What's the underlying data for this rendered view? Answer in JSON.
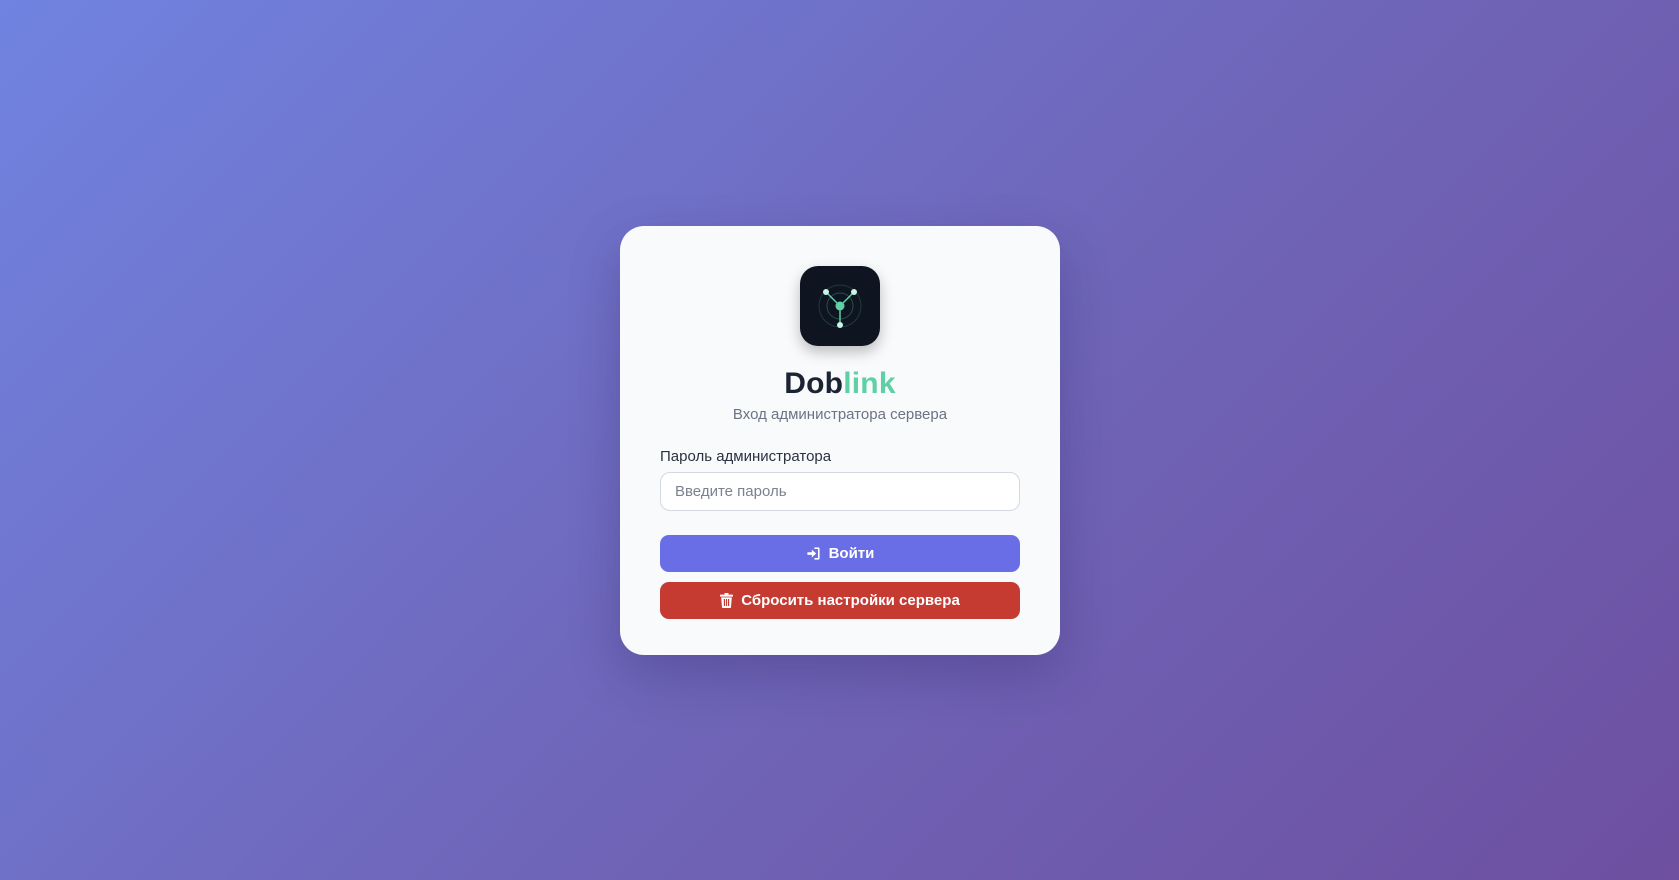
{
  "brand": {
    "name_part1": "Dob",
    "name_part2": "link",
    "accent_color": "#5fcfa5",
    "logo_icon": "network-nodes-icon"
  },
  "subtitle": "Вход администратора сервера",
  "password_field": {
    "label": "Пароль администратора",
    "placeholder": "Введите пароль",
    "value": ""
  },
  "login_button": {
    "label": "Войти",
    "icon": "sign-in-icon",
    "color": "#6a6ee6"
  },
  "reset_button": {
    "label": "Сбросить настройки сервера",
    "icon": "trash-icon",
    "color": "#c53a31"
  }
}
